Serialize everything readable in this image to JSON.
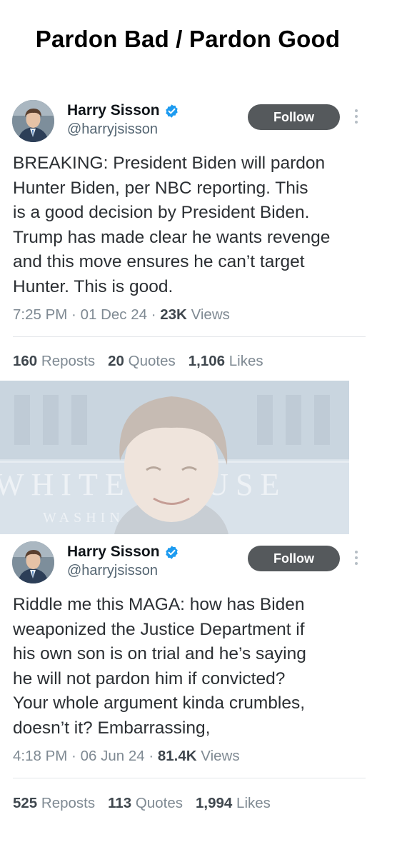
{
  "page": {
    "title": "Pardon Bad / Pardon Good"
  },
  "tweets": [
    {
      "display_name": "Harry Sisson",
      "handle": "@harryjsisson",
      "follow_label": "Follow",
      "text": "BREAKING: President Biden will pardon\nHunter Biden, per NBC reporting. This\nis a good decision by President Biden.\nTrump has made clear he wants revenge\nand this move ensures he can’t target\nHunter. This is good.",
      "time": "7:25 PM",
      "date": "01 Dec 24",
      "views_count": "23K",
      "views_label": "Views",
      "reposts_count": "160",
      "reposts_label": "Reposts",
      "quotes_count": "20",
      "quotes_label": "Quotes",
      "likes_count": "1,106",
      "likes_label": "Likes"
    },
    {
      "display_name": "Harry Sisson",
      "handle": "@harryjsisson",
      "follow_label": "Follow",
      "text": "Riddle me this MAGA: how has Biden\nweaponized the Justice Department if\nhis own son is on trial and he’s saying\nhe will not pardon him if convicted?\nYour whole argument kinda crumbles,\ndoesn’t it? Embarrassing,",
      "time": "4:18 PM",
      "date": "06 Jun 24",
      "views_count": "81.4K",
      "views_label": "Views",
      "reposts_count": "525",
      "reposts_label": "Reposts",
      "quotes_count": "113",
      "quotes_label": "Quotes",
      "likes_count": "1,994",
      "likes_label": "Likes"
    }
  ],
  "photo": {
    "background_text": "WHITE HOUSE",
    "background_text_2": "WASHINGTON"
  },
  "colors": {
    "verified_blue": "#1d9bf0",
    "follow_bg": "#55595c",
    "muted_text": "#7f8a93"
  },
  "icons": {
    "verified": "verified-badge-icon",
    "more": "more-options-icon"
  }
}
